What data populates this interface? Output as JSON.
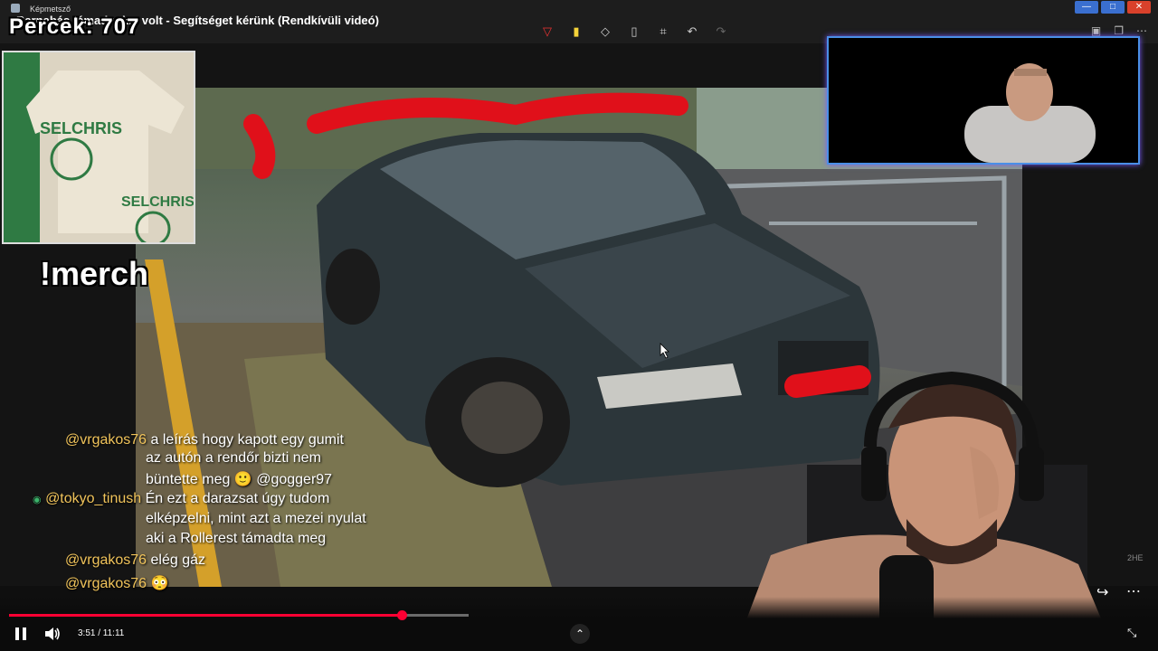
{
  "window": {
    "app_name": "Képmetsző",
    "video_title": "Barnabás támadunk... volt - Segítséget kérünk (Rendkívüli videó)"
  },
  "overlay": {
    "counter_label": "Percek:",
    "counter_value": "707",
    "merch_command": "!merch"
  },
  "merch": {
    "brand": "SELCHRIS",
    "brand2": "SELCHRIS"
  },
  "chat": [
    {
      "user": "@vrgakos76",
      "text": "a leírás hogy kapott egy gumit"
    },
    {
      "user": "",
      "text": "az autón a rendőr bizti nem"
    },
    {
      "user": "",
      "text": "büntette meg 🙂 @gogger97"
    },
    {
      "user": "@tokyo_tinush",
      "text": "Én ezt a darazsat úgy tudom"
    },
    {
      "user": "",
      "text": "elképzelni, mint azt a mezei nyulat"
    },
    {
      "user": "",
      "text": "aki a Rollerest támadta meg"
    },
    {
      "user": "@vrgakos76",
      "text": "elég gáz"
    },
    {
      "user": "@vrgakos76",
      "text": "😳"
    }
  ],
  "player": {
    "time_display": "3:51 / 11:11",
    "progress": 0.854,
    "side_badge": "2HE"
  },
  "colors": {
    "progress": "#ff0033",
    "cam_border": "#4a8fe7",
    "chat_user": "#f0c35a"
  }
}
